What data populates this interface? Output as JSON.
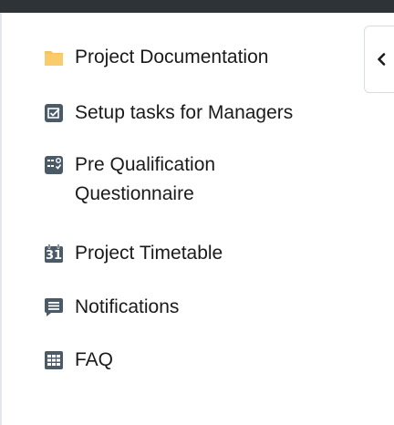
{
  "sidebar": {
    "items": [
      {
        "label": "Project Documentation",
        "icon": "folder-icon"
      },
      {
        "label": "Setup tasks for Managers",
        "icon": "checkbox-icon"
      },
      {
        "label": "Pre Qualification Questionnaire",
        "icon": "questionnaire-icon"
      },
      {
        "label": "Project Timetable",
        "icon": "calendar-icon",
        "calendar_day": "31"
      },
      {
        "label": "Notifications",
        "icon": "message-icon"
      },
      {
        "label": "FAQ",
        "icon": "grid-icon"
      }
    ],
    "collapse_icon": "chevron-left-icon"
  },
  "colors": {
    "topbar": "#2e3338",
    "folder": "#f7c35f",
    "icon": "#4b5a67",
    "text": "#1a1a1a"
  }
}
